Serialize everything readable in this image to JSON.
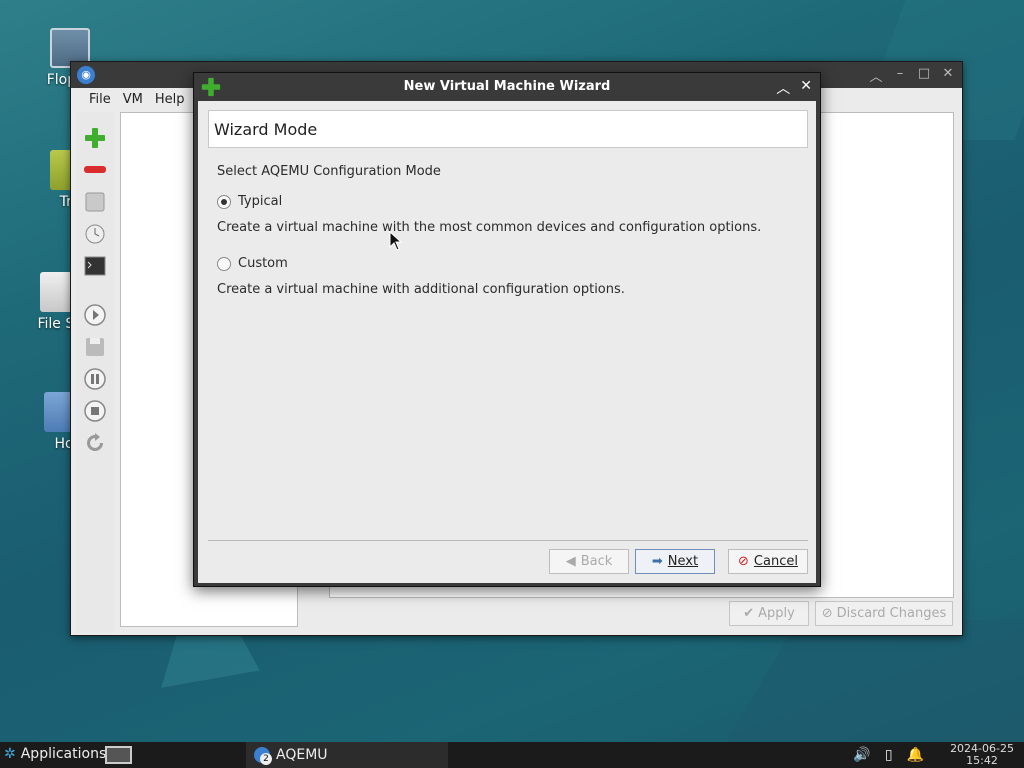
{
  "desktop": {
    "icons": [
      {
        "label": "Floppy"
      },
      {
        "label": "Tra"
      },
      {
        "label": "File Sy"
      },
      {
        "label": "Ho"
      }
    ]
  },
  "main_window": {
    "menu": [
      "File",
      "VM",
      "Help"
    ],
    "apply_label": "Apply",
    "discard_label": "Discard Changes"
  },
  "wizard": {
    "title": "New Virtual Machine Wizard",
    "mode_heading": "Wizard Mode",
    "section_label": "Select AQEMU Configuration Mode",
    "options": [
      {
        "label": "Typical",
        "selected": true,
        "description": "Create a virtual machine with the most common devices and configuration options."
      },
      {
        "label": "Custom",
        "selected": false,
        "description": "Create a virtual machine with additional configuration options."
      }
    ],
    "back_label": "Back",
    "next_label": "Next",
    "cancel_label": "Cancel"
  },
  "taskbar": {
    "applications_label": "Applications",
    "task_label": "AQEMU",
    "task_count": "2",
    "date": "2024-06-25",
    "time": "15:42"
  },
  "colors": {
    "accent_green": "#3fae2f",
    "delete_red": "#d92c2c",
    "cancel_red": "#cc2222"
  }
}
